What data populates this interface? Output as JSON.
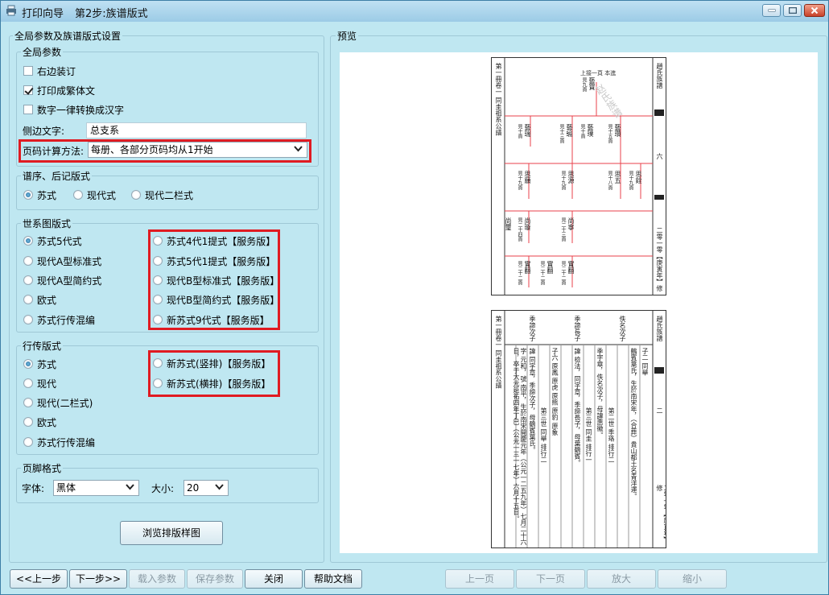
{
  "window": {
    "title": "打印向导",
    "step": "第2步:族谱版式"
  },
  "settings": {
    "group_title": "全局参数及族谱版式设置",
    "global": {
      "title": "全局参数",
      "checkboxes": [
        {
          "label": "右边装订",
          "checked": false
        },
        {
          "label": "打印成繁体文",
          "checked": true
        },
        {
          "label": "数字一律转换成汉字",
          "checked": false
        }
      ],
      "side_text_label": "侧边文字:",
      "side_text_value": "总支系",
      "page_calc_label": "页码计算方法:",
      "page_calc_value": "每册、各部分页码均从1开始"
    },
    "preface": {
      "title": "谱序、后记版式",
      "options": [
        {
          "label": "苏式",
          "checked": true
        },
        {
          "label": "现代式",
          "checked": false
        },
        {
          "label": "现代二栏式",
          "checked": false
        }
      ]
    },
    "lineage": {
      "title": "世系图版式",
      "left_options": [
        {
          "label": "苏式5代式",
          "checked": true
        },
        {
          "label": "现代A型标准式",
          "checked": false
        },
        {
          "label": "现代A型简约式",
          "checked": false
        },
        {
          "label": "欧式",
          "checked": false
        },
        {
          "label": "苏式行传混编",
          "checked": false
        }
      ],
      "right_options": [
        {
          "label": "苏式4代1提式【服务版】",
          "checked": false
        },
        {
          "label": "苏式5代1提式【服务版】",
          "checked": false
        },
        {
          "label": "现代B型标准式【服务版】",
          "checked": false
        },
        {
          "label": "现代B型简约式【服务版】",
          "checked": false
        },
        {
          "label": "新苏式9代式【服务版】",
          "checked": false
        }
      ]
    },
    "biography": {
      "title": "行传版式",
      "left_options": [
        {
          "label": "苏式",
          "checked": true
        },
        {
          "label": "现代",
          "checked": false
        },
        {
          "label": "现代(二栏式)",
          "checked": false
        },
        {
          "label": "欧式",
          "checked": false
        },
        {
          "label": "苏式行传混编",
          "checked": false
        }
      ],
      "right_options": [
        {
          "label": "新苏式(竖排)【服务版】",
          "checked": false
        },
        {
          "label": "新苏式(横排)【服务版】",
          "checked": false
        }
      ]
    },
    "footer": {
      "title": "页脚格式",
      "font_label": "字体:",
      "font_value": "黑体",
      "size_label": "大小:",
      "size_value": "20"
    },
    "browse_button": "浏览排版样图"
  },
  "preview": {
    "title": "预览",
    "page1": {
      "header_right": "趙氏族譜",
      "side_left": "第一冊卷一 同圭祖系公譜",
      "side_right_mid": "六",
      "side_right_bottom": "二零一零【庚寅年】修",
      "watermark": "赵氏族谱",
      "top_line": "上接一頁 本進",
      "names": [
        {
          "name": "藝寶",
          "note": "見九頁"
        },
        {
          "name": "藝瑞",
          "note": "見十頁"
        },
        {
          "name": "藝璞",
          "note": "見十頁"
        },
        {
          "name": "藝瑜",
          "note": "見十三頁"
        },
        {
          "name": "藝瓚",
          "note": "見十五頁"
        },
        {
          "name": "思五",
          "note": "見十八頁"
        },
        {
          "name": "思銓",
          "note": "見十九頁"
        },
        {
          "name": "思願",
          "note": "見十九頁"
        },
        {
          "name": "思源",
          "note": "見十九頁"
        },
        {
          "name": "尚璇",
          "note": "見二十四頁"
        },
        {
          "name": "尚寧",
          "note": "見二十三頁"
        },
        {
          "name": "尚璽",
          "note": ""
        },
        {
          "name": "實翻",
          "note": "見二十二頁"
        },
        {
          "name": "實翻",
          "note": "見二十二頁"
        },
        {
          "name": "實翻",
          "note": "見二十二頁"
        }
      ]
    },
    "page2": {
      "header_right": "趙氏族譜",
      "side_left": "第一冊卷一 同圭祖系公譜",
      "side_right_mid": "二",
      "side_right_bottom": "二零一零【庚寅年】修",
      "columns": [
        "子二 同舉",
        "鶴賓葉氏，生於南宋年，（合葬）貴山都土名青洋運。",
        "佚名次子",
        "第二世 季珞 排行二",
        "季字章，佚名次子，母諱惠徽。",
        "第三世 同圭 排行一",
        "諱 檢法，同字章，季諦長子，母葉鶴賓。",
        "季諦長子",
        "子六 原鳳 原虎 原熊 原豹 原象",
        "第三世 同舉 排行二",
        "諱 同字章，季諦次子，母鶴賓葉氏。",
        "字 元和，號 南平，生於南宋開慶元年（公元一二五九年）七月二十六日，卒于大元延祐四年丁巳（公元一三一七年）六月十五日。",
        "季諦次子"
      ]
    }
  },
  "buttons": {
    "prev": "<<上一步",
    "next": "下一步>>",
    "load": "载入参数",
    "save": "保存参数",
    "close": "关闭",
    "help": "帮助文档",
    "prev_page": "上一页",
    "next_page": "下一页",
    "zoom_in": "放大",
    "zoom_out": "缩小"
  },
  "colors": {
    "window_bg": "#bfe7f1",
    "highlight_box": "#e01b22",
    "lineage_line": "#e8424b"
  }
}
